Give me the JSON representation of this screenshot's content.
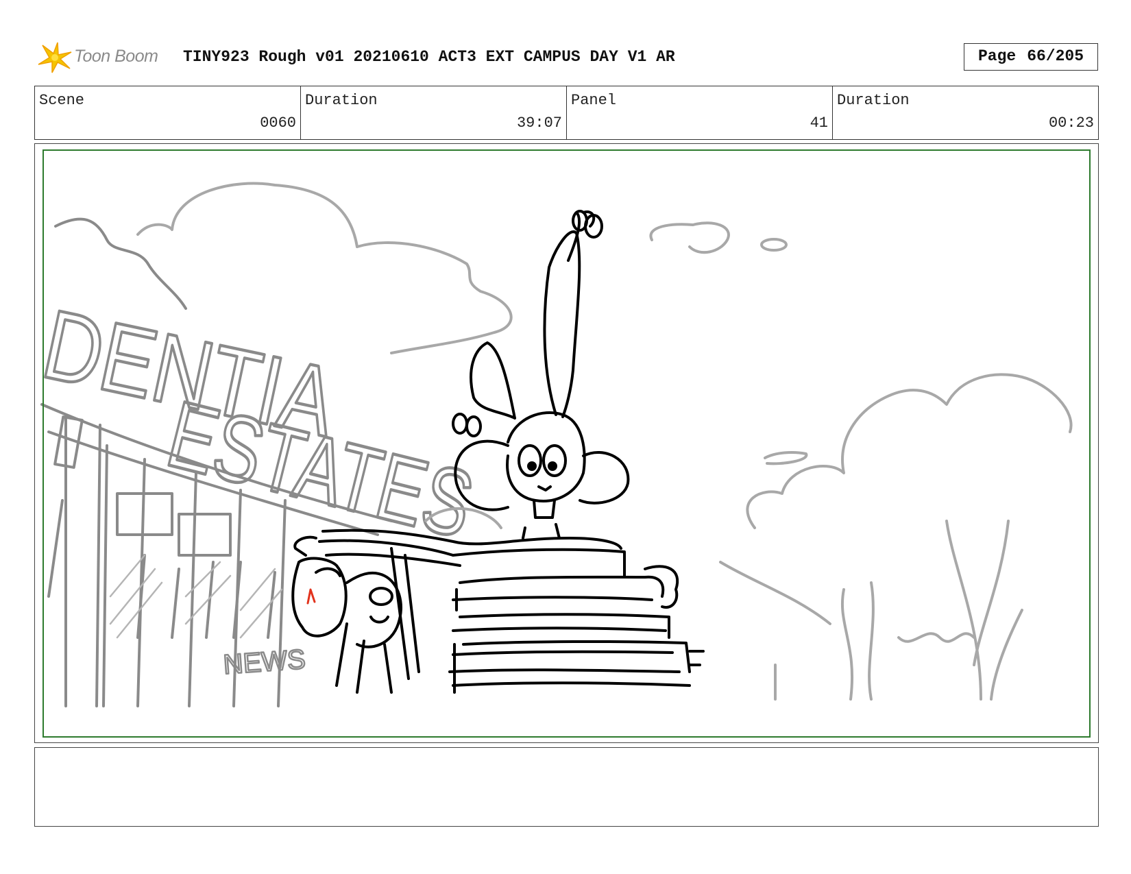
{
  "header": {
    "logo_text": "Toon Boom",
    "title": "TINY923 Rough v01 20210610 ACT3 EXT CAMPUS DAY V1 AR",
    "page_label": "Page",
    "page_value": "66/205"
  },
  "info": {
    "scene_label": "Scene",
    "scene_value": "0060",
    "scene_duration_label": "Duration",
    "scene_duration_value": "39:07",
    "panel_label": "Panel",
    "panel_value": "41",
    "panel_duration_label": "Duration",
    "panel_duration_value": "00:23"
  },
  "sketch": {
    "sign_lines": [
      "DENTIA",
      "ESTATES"
    ],
    "news_sign": "NEWS"
  },
  "notes": {
    "text": ""
  },
  "colors": {
    "safe_frame": "#2d7a2d",
    "logo_star": "#f5c400",
    "sketch_background": "#9a9a9a",
    "sketch_foreground": "#000000"
  }
}
